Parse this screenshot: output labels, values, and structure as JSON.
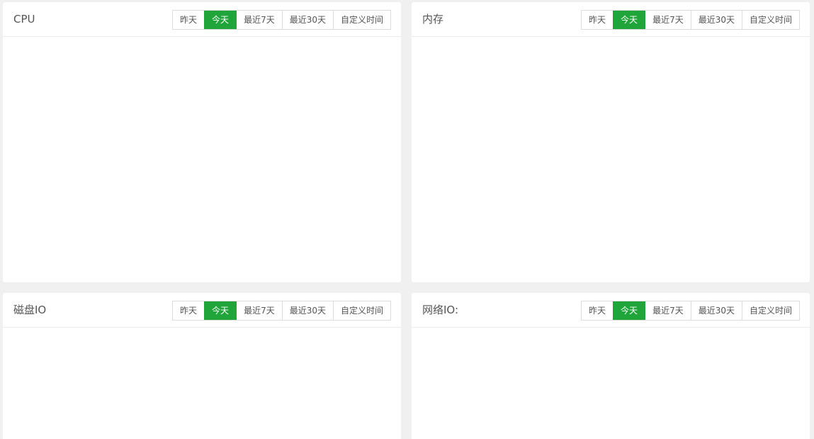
{
  "panels": [
    {
      "title": "CPU",
      "active_range": 1,
      "ranges": [
        "昨天",
        "今天",
        "最近7天",
        "最近30天",
        "自定义时间"
      ]
    },
    {
      "title": "内存",
      "active_range": 1,
      "ranges": [
        "昨天",
        "今天",
        "最近7天",
        "最近30天",
        "自定义时间"
      ]
    },
    {
      "title": "磁盘IO",
      "active_range": 1,
      "ranges": [
        "昨天",
        "今天",
        "最近7天",
        "最近30天",
        "自定义时间"
      ]
    },
    {
      "title": "网络IO:",
      "active_range": 1,
      "ranges": [
        "昨天",
        "今天",
        "最近7天",
        "最近30天",
        "自定义时间"
      ]
    }
  ],
  "colors": {
    "accent": "#20a53a",
    "page_background": "#f0f0f0",
    "panel_background": "#ffffff"
  }
}
